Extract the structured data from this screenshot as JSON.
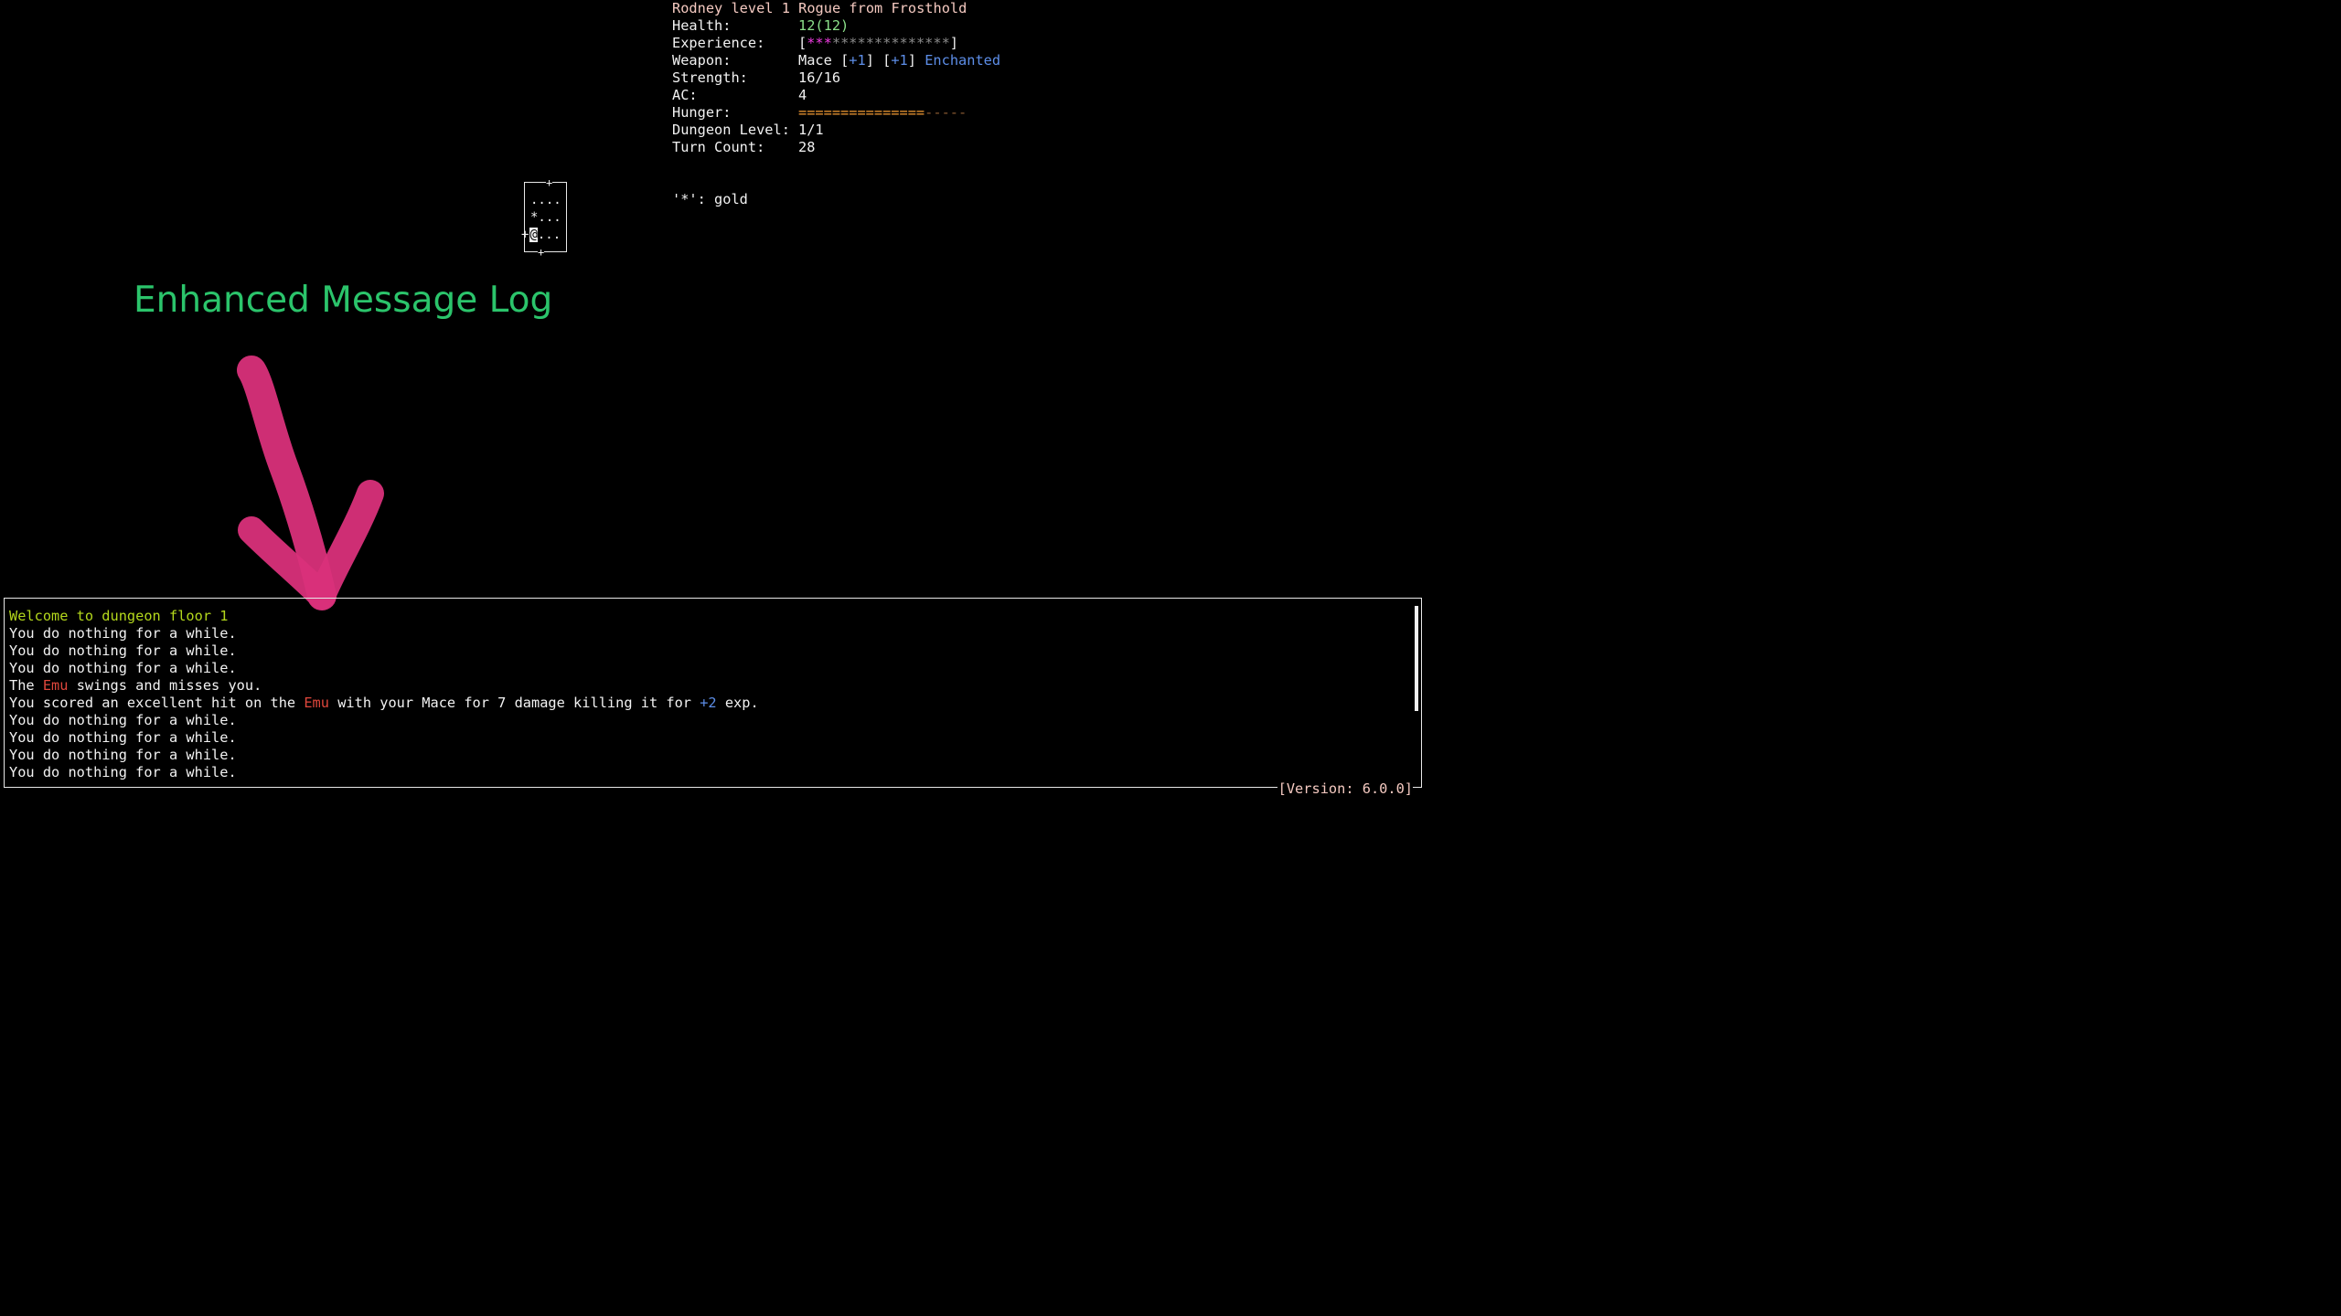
{
  "stats": {
    "title": "Rodney level 1 Rogue from Frosthold",
    "health_label": "Health:",
    "health_value": "12(12)",
    "experience_label": "Experience:",
    "experience_open": "[",
    "experience_filled": "***",
    "experience_empty": "**************",
    "experience_close": "]",
    "experience_fraction": 0.18,
    "weapon_label": "Weapon:",
    "weapon_name": "Mace ",
    "weapon_mod1_open": "[",
    "weapon_mod1": "+1",
    "weapon_mod1_close": "] ",
    "weapon_mod2_open": "[",
    "weapon_mod2": "+1",
    "weapon_mod2_close": "] ",
    "weapon_enchant": "Enchanted",
    "strength_label": "Strength:",
    "strength_value": "16/16",
    "ac_label": "AC:",
    "ac_value": "4",
    "hunger_label": "Hunger:",
    "hunger_filled": "===============",
    "hunger_empty": "-----",
    "hunger_fraction": 0.75,
    "dungeon_level_label": "Dungeon Level:",
    "dungeon_level_value": "1/1",
    "turn_count_label": "Turn Count:",
    "turn_count_value": "28"
  },
  "legend": {
    "entry": "'*': gold"
  },
  "map": {
    "row1": "....",
    "row2": "*...",
    "row3_prefix": "+",
    "row3_player": "@",
    "row3_rest": "...",
    "door_top": "+",
    "door_bottom": "+"
  },
  "annotation": {
    "title": "Enhanced Message Log"
  },
  "log": {
    "lines": [
      {
        "parts": [
          {
            "text": "Welcome to dungeon floor 1",
            "color": "#b4d81c"
          }
        ]
      },
      {
        "parts": [
          {
            "text": "You do nothing for a while.",
            "color": "#f2f2f2"
          }
        ]
      },
      {
        "parts": [
          {
            "text": "You do nothing for a while.",
            "color": "#f2f2f2"
          }
        ]
      },
      {
        "parts": [
          {
            "text": "You do nothing for a while.",
            "color": "#f2f2f2"
          }
        ]
      },
      {
        "parts": [
          {
            "text": "The ",
            "color": "#f2f2f2"
          },
          {
            "text": "Emu",
            "color": "#e0473c"
          },
          {
            "text": " swings and misses you.",
            "color": "#f2f2f2"
          }
        ]
      },
      {
        "parts": [
          {
            "text": "You scored an excellent hit on the ",
            "color": "#f2f2f2"
          },
          {
            "text": "Emu",
            "color": "#e0473c"
          },
          {
            "text": " with your Mace for 7 damage killing it for ",
            "color": "#f2f2f2"
          },
          {
            "text": "+2",
            "color": "#5d8ee8"
          },
          {
            "text": " exp.",
            "color": "#f2f2f2"
          }
        ]
      },
      {
        "parts": [
          {
            "text": "You do nothing for a while.",
            "color": "#f2f2f2"
          }
        ]
      },
      {
        "parts": [
          {
            "text": "You do nothing for a while.",
            "color": "#f2f2f2"
          }
        ]
      },
      {
        "parts": [
          {
            "text": "You do nothing for a while.",
            "color": "#f2f2f2"
          }
        ]
      },
      {
        "parts": [
          {
            "text": "You do nothing for a while.",
            "color": "#f2f2f2"
          }
        ]
      }
    ],
    "version": "[Version: 6.0.0]"
  },
  "colors": {
    "background": "#000000",
    "annotation_green": "#2bc46b",
    "arrow_pink": "#d9307a",
    "title_peach": "#f4c9c0"
  }
}
